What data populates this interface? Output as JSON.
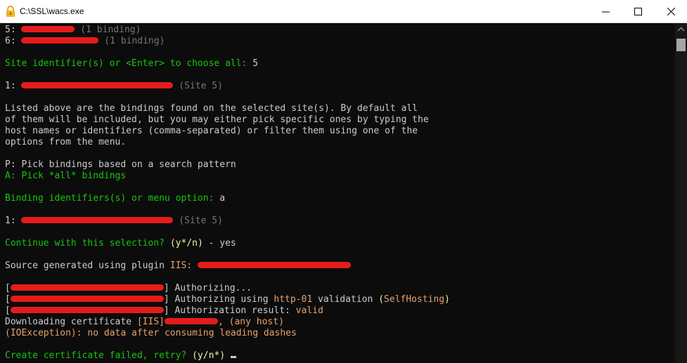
{
  "window": {
    "title": "C:\\SSL\\wacs.exe",
    "icon": "lock-icon"
  },
  "console": {
    "l1_num": "5: ",
    "l1_suffix": " (1 binding)",
    "l2_num": "6: ",
    "l2_suffix": " (1 binding)",
    "l3_prompt": "Site identifier(s) or <Enter> to choose all: ",
    "l3_answer": "5",
    "l4_num": "1: ",
    "l4_suffix": " (Site 5)",
    "para1": "Listed above are the bindings found on the selected site(s). By default all",
    "para2": "of them will be included, but you may either pick specific ones by typing the",
    "para3": "host names or identifiers (comma-separated) or filter them using one of the",
    "para4": "options from the menu.",
    "menu_p": "P: Pick bindings based on a search pattern",
    "menu_a": "A: Pick *all* bindings",
    "binding_prompt": "Binding identifiers(s) or menu option: ",
    "binding_answer": "a",
    "sel_num": "1: ",
    "sel_suffix": " (Site 5)",
    "continue_prompt": "Continue with this selection? ",
    "continue_options": "(y*/n)",
    "continue_answer": " - yes",
    "source_text": "Source generated using plugin ",
    "source_plugin": "IIS:",
    "auth1_open": "[",
    "auth1_close": "] ",
    "auth1_text": "Authorizing...",
    "auth2_text": "Authorizing using ",
    "auth2_method": "http-01",
    "auth2_mid": " validation ",
    "auth2_paren_open": "(",
    "auth2_hosting": "SelfHosting",
    "auth2_paren_close": ")",
    "auth3_text": "Authorization result: ",
    "auth3_result": "valid",
    "download_text": "Downloading certificate ",
    "download_tag": "[IIS]",
    "download_host": ", (any host)",
    "error_type": "(IOException)",
    "error_msg": ": no data after consuming leading dashes",
    "retry_prompt": "Create certificate failed, retry? ",
    "retry_options": "(y/n*)",
    "retry_space": " "
  },
  "colors": {
    "background": "#0c0c0c",
    "text": "#cccccc",
    "green": "#16c60c",
    "yellow": "#f9f1a5",
    "orange": "#e6a26a",
    "redaction": "#e41c1c"
  }
}
